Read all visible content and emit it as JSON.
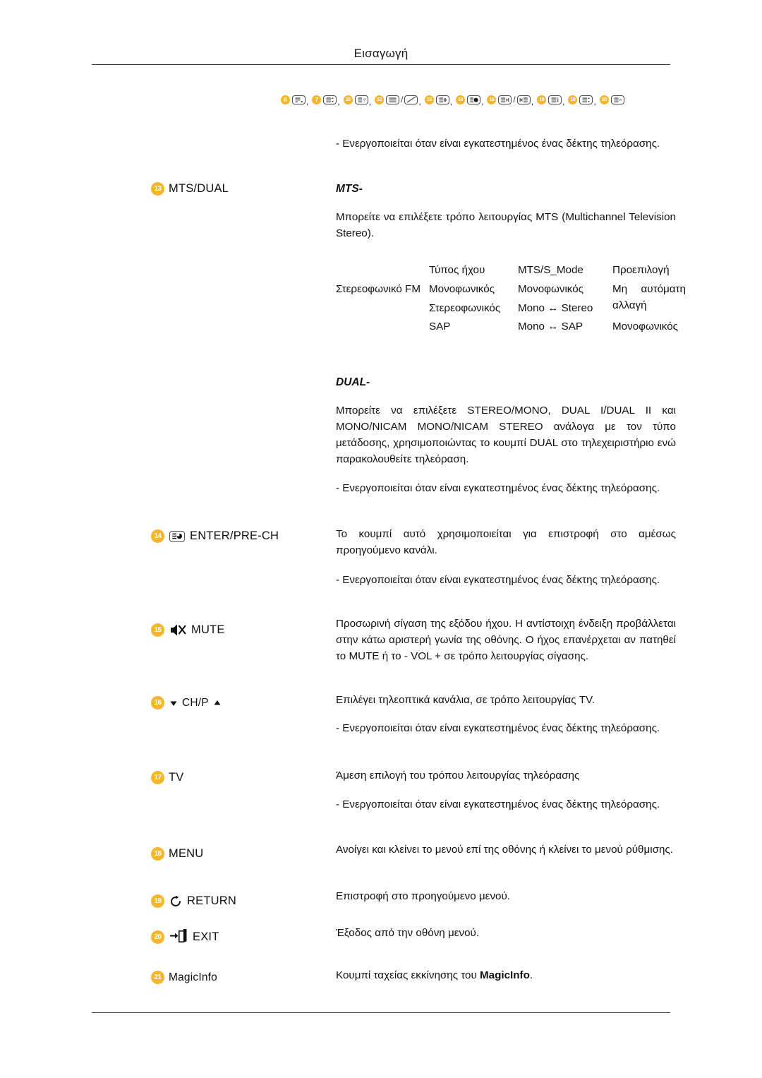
{
  "page": {
    "header_title": "Εισαγωγή",
    "accent_color": "#F7B52B",
    "text_color": "#111111"
  },
  "icon_summary": {
    "items": [
      {
        "number": "6",
        "icon": "remote-key-lines-icon",
        "separator": ","
      },
      {
        "number": "7",
        "icon": "remote-key-lines-updown-icon",
        "separator": ","
      },
      {
        "number": "10",
        "icon": "remote-key-question-icon",
        "separator": ","
      },
      {
        "number": "12",
        "icon": "remote-key-lines-icon",
        "icon2": "remote-key-diagonal-icon",
        "separator": ","
      },
      {
        "number": "13",
        "icon": "remote-key-diamond-icon",
        "separator": ","
      },
      {
        "number": "14",
        "icon": "remote-key-pie-icon",
        "separator": ","
      },
      {
        "number": "16",
        "icon": "remote-key-next-icon",
        "icon2": "remote-key-prev-icon",
        "separator": ","
      },
      {
        "number": "18",
        "icon": "remote-key-info-icon",
        "separator": ","
      },
      {
        "number": "19",
        "icon": "remote-key-lines-updown-icon",
        "separator": ","
      },
      {
        "number": "20",
        "icon": "remote-key-close-icon",
        "separator": ""
      }
    ]
  },
  "entries": [
    {
      "number": "13",
      "label": "MTS/DUAL",
      "icon": null,
      "notes": [
        {
          "type": "note",
          "text": "- Ενεργοποιείται όταν είναι εγκατεστημένος ένας δέκτης τηλεόρασης."
        },
        {
          "type": "heading",
          "text": "MTS-"
        },
        {
          "type": "body",
          "text": "Μπορείτε να επιλέξετε τρόπο λειτουργίας MTS (Multichannel Television Stereo)."
        },
        {
          "type": "heading",
          "text": "DUAL-"
        },
        {
          "type": "body",
          "text": "Μπορείτε να επιλέξετε STEREO/MONO, DUAL I/DUAL II και MONO/NICAM MONO/NICAM STEREO ανάλογα με τον τύπο μετάδοσης, χρησιμοποιώντας το κουμπί DUAL στο τηλεχειριστήριο ενώ παρακολουθείτε τηλεόραση."
        },
        {
          "type": "note",
          "text": "- Ενεργοποιείται όταν είναι εγκατεστημένος ένας δέκτης τηλεόρασης."
        }
      ]
    },
    {
      "number": "14",
      "label": "ENTER/PRE-CH",
      "icon": "remote-key-pie-icon",
      "notes": [
        {
          "type": "body",
          "text": "Το κουμπί αυτό χρησιμοποιείται για επιστροφή στο αμέσως προηγούμενο κανάλι."
        },
        {
          "type": "note",
          "text": "- Ενεργοποιείται όταν είναι εγκατεστημένος ένας δέκτης τηλεόρασης."
        }
      ]
    },
    {
      "number": "15",
      "label": "MUTE",
      "icon": "speaker-mute-icon",
      "notes": [
        {
          "type": "body",
          "text": "Προσωρινή σίγαση της εξόδου ήχου. Η αντίστοιχη ένδειξη προβάλλεται στην κάτω αριστερή γωνία της οθόνης. Ο ήχος επανέρχεται αν πατηθεί το MUTE ή το - VOL + σε τρόπο λειτουργίας σίγασης."
        }
      ]
    },
    {
      "number": "16",
      "label": "CH/P",
      "icon": "chevron-down-up-icon",
      "notes": [
        {
          "type": "body",
          "text": "Επιλέγει τηλεοπτικά κανάλια, σε τρόπο λειτουργίας TV."
        },
        {
          "type": "note",
          "text": "- Ενεργοποιείται όταν είναι εγκατεστημένος ένας δέκτης τηλεόρασης."
        }
      ]
    },
    {
      "number": "17",
      "label": "TV",
      "icon": null,
      "notes": [
        {
          "type": "body",
          "text": "Άμεση επιλογή του τρόπου λειτουργίας τηλεόρασης"
        },
        {
          "type": "note",
          "text": "- Ενεργοποιείται όταν είναι εγκατεστημένος ένας δέκτης τηλεόρασης."
        }
      ]
    },
    {
      "number": "18",
      "label": "MENU",
      "icon": null,
      "notes": [
        {
          "type": "body",
          "text": "Ανοίγει και κλείνει το μενού επί της οθόνης ή κλείνει το μενού ρύθμισης."
        }
      ]
    },
    {
      "number": "19",
      "label": "RETURN",
      "icon": "return-arrow-icon",
      "notes": [
        {
          "type": "body",
          "text": "Επιστροφή στο προηγούμενο μενού."
        }
      ]
    },
    {
      "number": "20",
      "label": "EXIT",
      "icon": "exit-door-icon",
      "notes": [
        {
          "type": "body",
          "text": "Έξοδος από την οθόνη μενού."
        }
      ]
    },
    {
      "number": "21",
      "label": "MagicInfo",
      "icon": null,
      "notes": [
        {
          "type": "body_rich",
          "text_before": "Κουμπί ταχείας εκκίνησης του ",
          "bold": "MagicInfo",
          "text_after": "."
        }
      ]
    }
  ],
  "mts_table": {
    "row_label": "Στερεοφωνικό FM",
    "headers": [
      "",
      "Τύπος ήχου",
      "MTS/S_Mode",
      "Προεπιλογή"
    ],
    "rows": [
      {
        "sound_type": "Μονοφωνικός",
        "mode": "Μονοφωνικός",
        "default": "Μη αυτόματη αλλαγή"
      },
      {
        "sound_type": "Στερεοφωνικός",
        "mode": "Mono ↔ Stereo",
        "default": ""
      },
      {
        "sound_type": "SAP",
        "mode": "Mono ↔ SAP",
        "default": "Μονοφωνικός"
      }
    ]
  }
}
